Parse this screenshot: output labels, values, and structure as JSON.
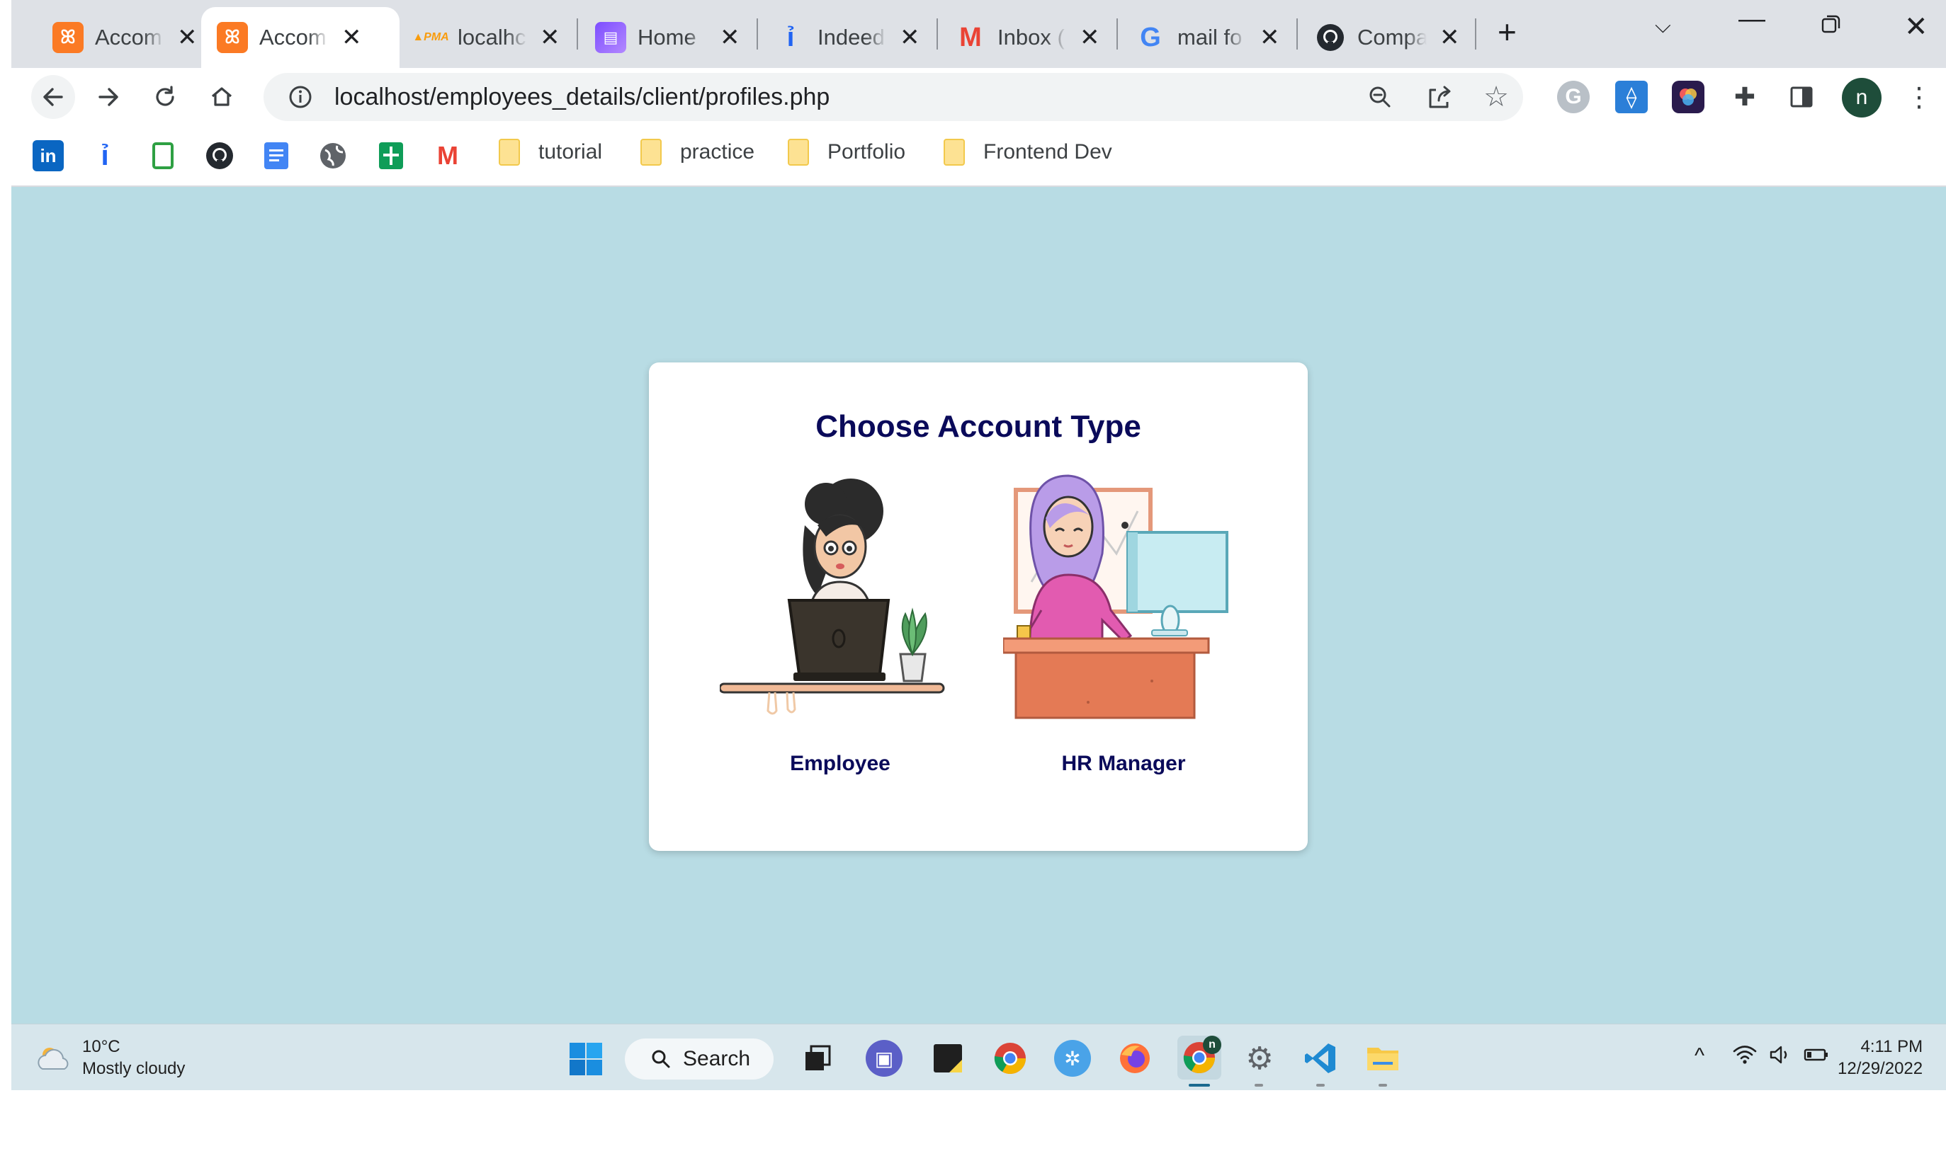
{
  "browser": {
    "tabs": [
      {
        "title": "Accom",
        "favicon": "xampp-icon",
        "active": false
      },
      {
        "title": "Accom",
        "favicon": "xampp-icon",
        "active": true
      },
      {
        "title": "localhc",
        "favicon": "phpmyadmin-icon",
        "active": false
      },
      {
        "title": "Home",
        "favicon": "clapperboard-icon",
        "active": false
      },
      {
        "title": "Indeed",
        "favicon": "indeed-icon",
        "active": false
      },
      {
        "title": "Inbox (",
        "favicon": "gmail-icon",
        "active": false
      },
      {
        "title": "mail fo",
        "favicon": "google-icon",
        "active": false
      },
      {
        "title": "Compa",
        "favicon": "github-icon",
        "active": false
      }
    ],
    "new_tab_glyph": "+",
    "address": "localhost/employees_details/client/profiles.php",
    "profile_initial": "n",
    "bookmarks": {
      "icons": [
        "linkedin-icon",
        "indeed-icon",
        "notes-icon",
        "github-icon",
        "docs-icon",
        "globe-icon",
        "sheets-icon",
        "gmail-icon"
      ],
      "folders": [
        "tutorial",
        "practice",
        "Portfolio",
        "Frontend Dev"
      ]
    }
  },
  "page": {
    "title": "Choose Account Type",
    "options": [
      {
        "label": "Employee",
        "illustration": "woman-with-laptop-illustration"
      },
      {
        "label": "HR Manager",
        "illustration": "woman-at-desktop-illustration"
      }
    ]
  },
  "taskbar": {
    "weather": {
      "temp": "10°C",
      "condition": "Mostly cloudy"
    },
    "search_label": "Search",
    "clock": {
      "time": "4:11 PM",
      "date": "12/29/2022"
    },
    "chrome_badge": "n"
  },
  "colors": {
    "page_background": "#b8dce4",
    "card_background": "#ffffff",
    "title_color": "#0a0a5a",
    "tab_strip": "#dee1e6"
  }
}
